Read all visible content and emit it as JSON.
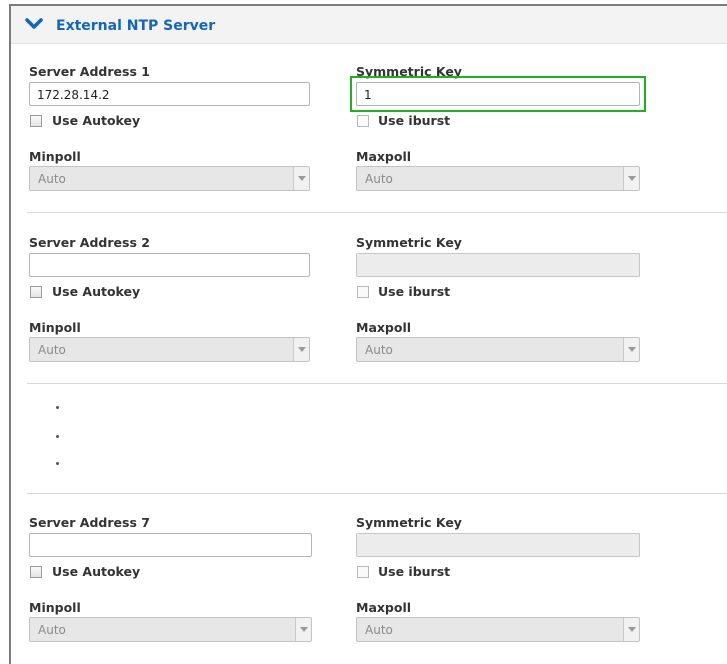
{
  "panel": {
    "title": "External NTP Server",
    "colors": {
      "title": "#1565b8",
      "focus": "#22b022"
    }
  },
  "servers": [
    {
      "address_label": "Server Address 1",
      "address_value": "172.28.14.2",
      "key_label": "Symmetric Key",
      "key_value": "1",
      "key_focused": true,
      "autokey_label": "Use Autokey",
      "autokey_checked": false,
      "iburst_label": "Use iburst",
      "iburst_checked": false,
      "minpoll_label": "Minpoll",
      "minpoll_value": "Auto",
      "maxpoll_label": "Maxpoll",
      "maxpoll_value": "Auto"
    },
    {
      "address_label": "Server Address 2",
      "address_value": "",
      "key_label": "Symmetric Key",
      "key_value": "",
      "key_focused": false,
      "autokey_label": "Use Autokey",
      "autokey_checked": false,
      "iburst_label": "Use iburst",
      "iburst_checked": false,
      "minpoll_label": "Minpoll",
      "minpoll_value": "Auto",
      "maxpoll_label": "Maxpoll",
      "maxpoll_value": "Auto"
    },
    {
      "address_label": "Server Address 7",
      "address_value": "",
      "key_label": "Symmetric Key",
      "key_value": "",
      "key_focused": false,
      "autokey_label": "Use Autokey",
      "autokey_checked": false,
      "iburst_label": "Use iburst",
      "iburst_checked": false,
      "minpoll_label": "Minpoll",
      "minpoll_value": "Auto",
      "maxpoll_label": "Maxpoll",
      "maxpoll_value": "Auto"
    }
  ]
}
